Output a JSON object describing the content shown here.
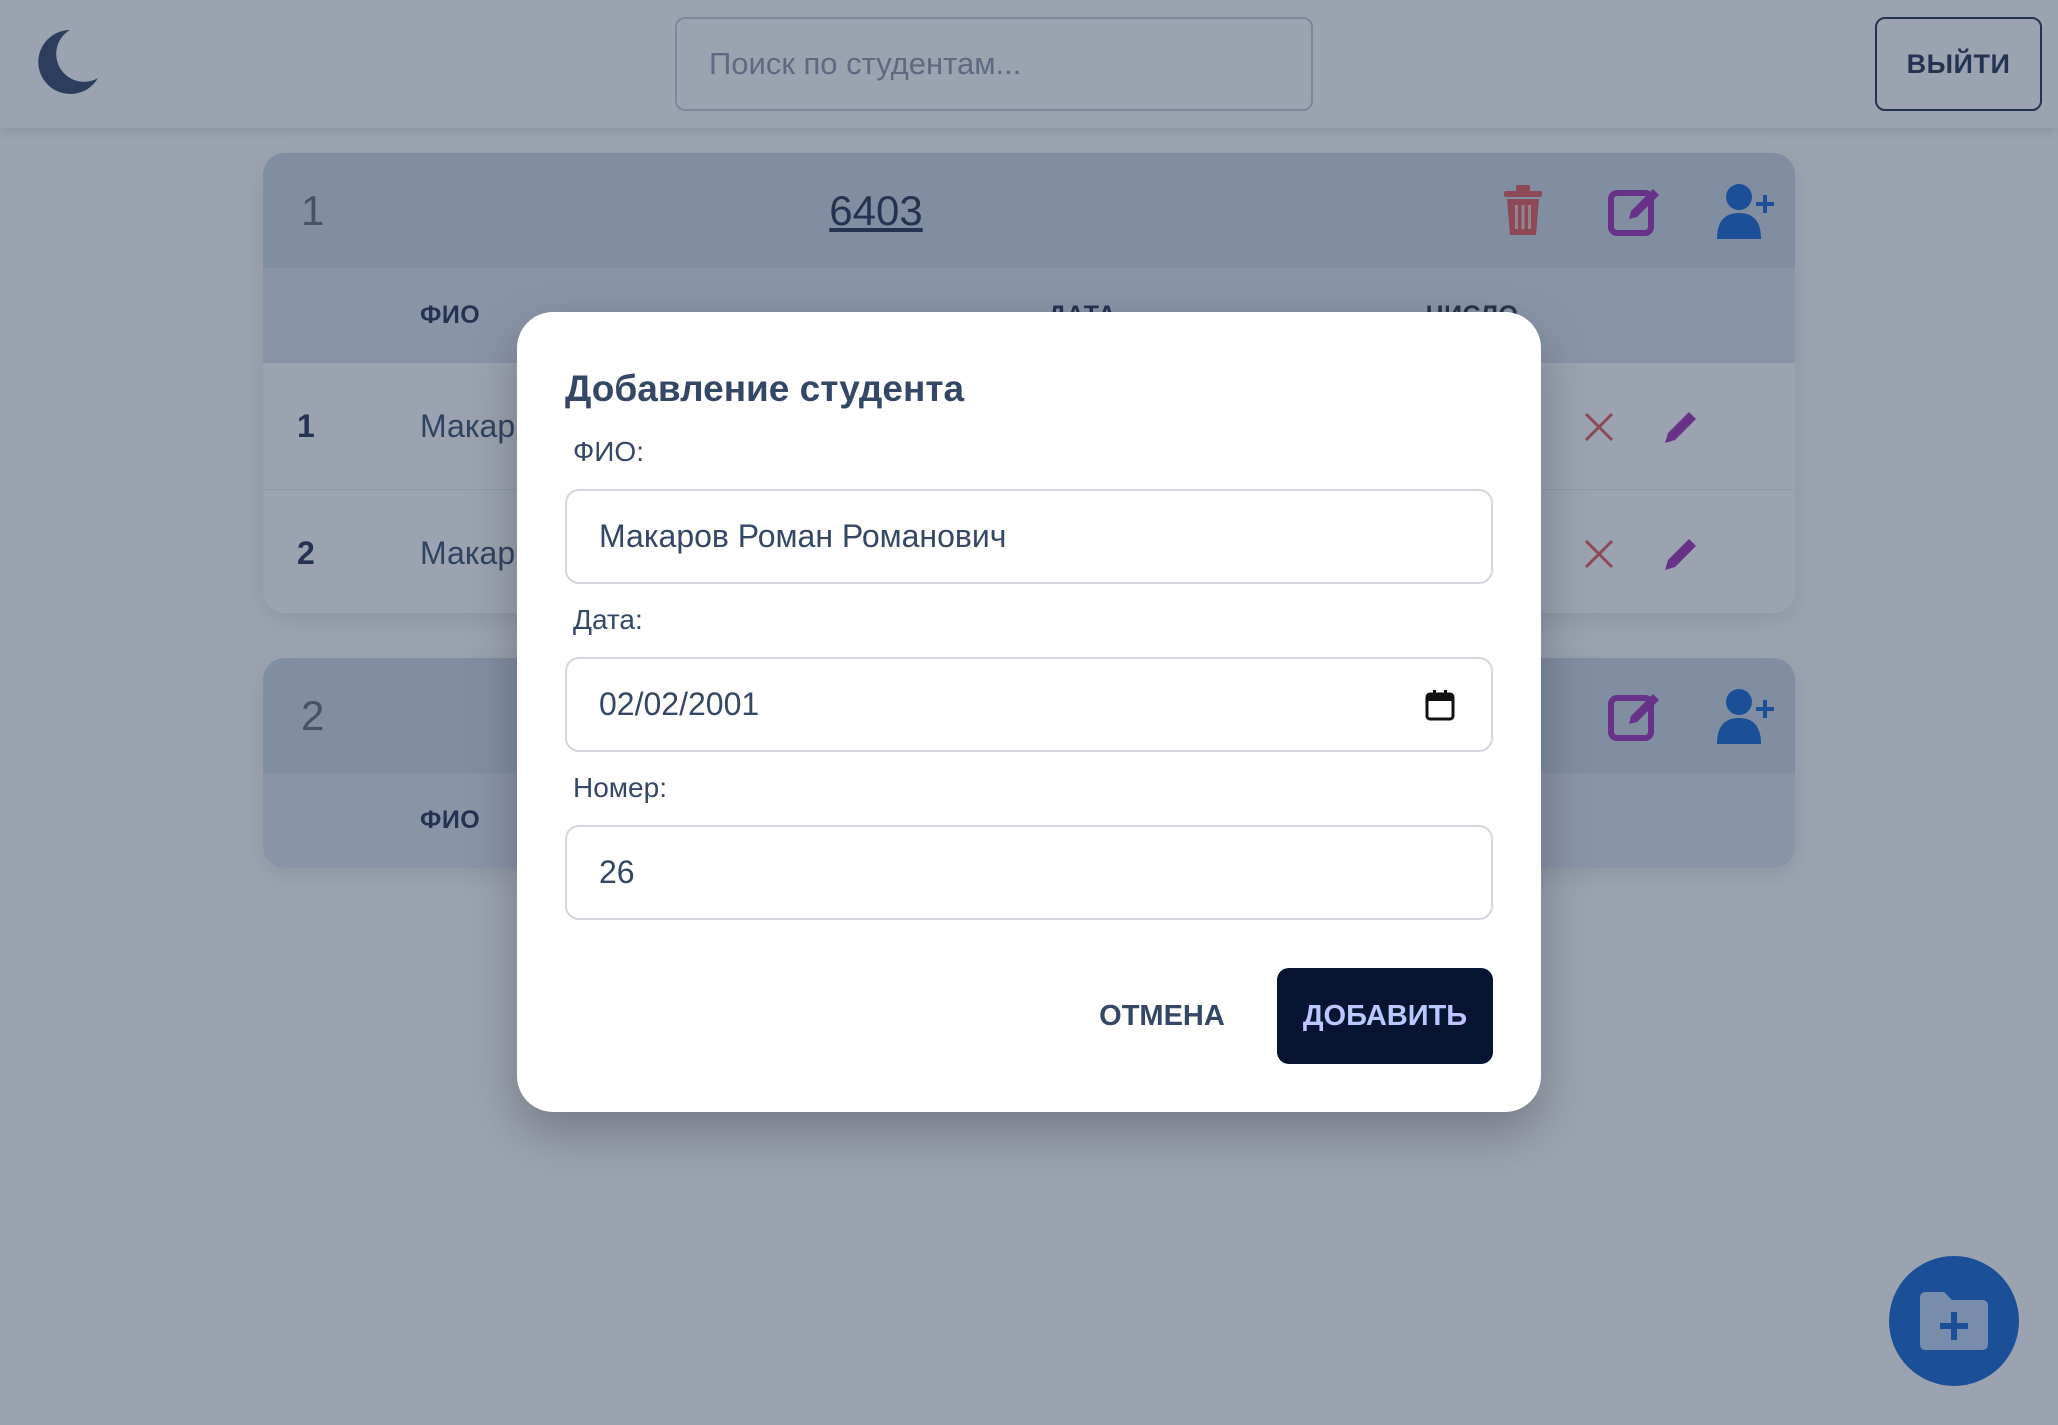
{
  "header": {
    "search_placeholder": "Поиск по студентам...",
    "logout_label": "ВЫЙТИ",
    "theme_icon": "moon-icon"
  },
  "groups": [
    {
      "index": "1",
      "name": "6403",
      "columns": [
        "ФИО",
        "ДАТА",
        "ЧИСЛО"
      ],
      "students": [
        {
          "num": "1",
          "fio": "Макар"
        },
        {
          "num": "2",
          "fio": "Макар"
        }
      ]
    },
    {
      "index": "2",
      "columns": [
        "ФИО"
      ]
    }
  ],
  "modal": {
    "title": "Добавление студента",
    "fio_label": "ФИО:",
    "fio_value": "Макаров Роман Романович",
    "date_label": "Дата:",
    "date_value": "02/02/2001",
    "number_label": "Номер:",
    "number_value": "26",
    "cancel_label": "ОТМЕНА",
    "add_label": "ДОБАВИТЬ"
  },
  "colors": {
    "accent": "#0a5fd0",
    "delete": "#e55353",
    "edit": "#9c27b0",
    "primary_dark": "#071533"
  }
}
